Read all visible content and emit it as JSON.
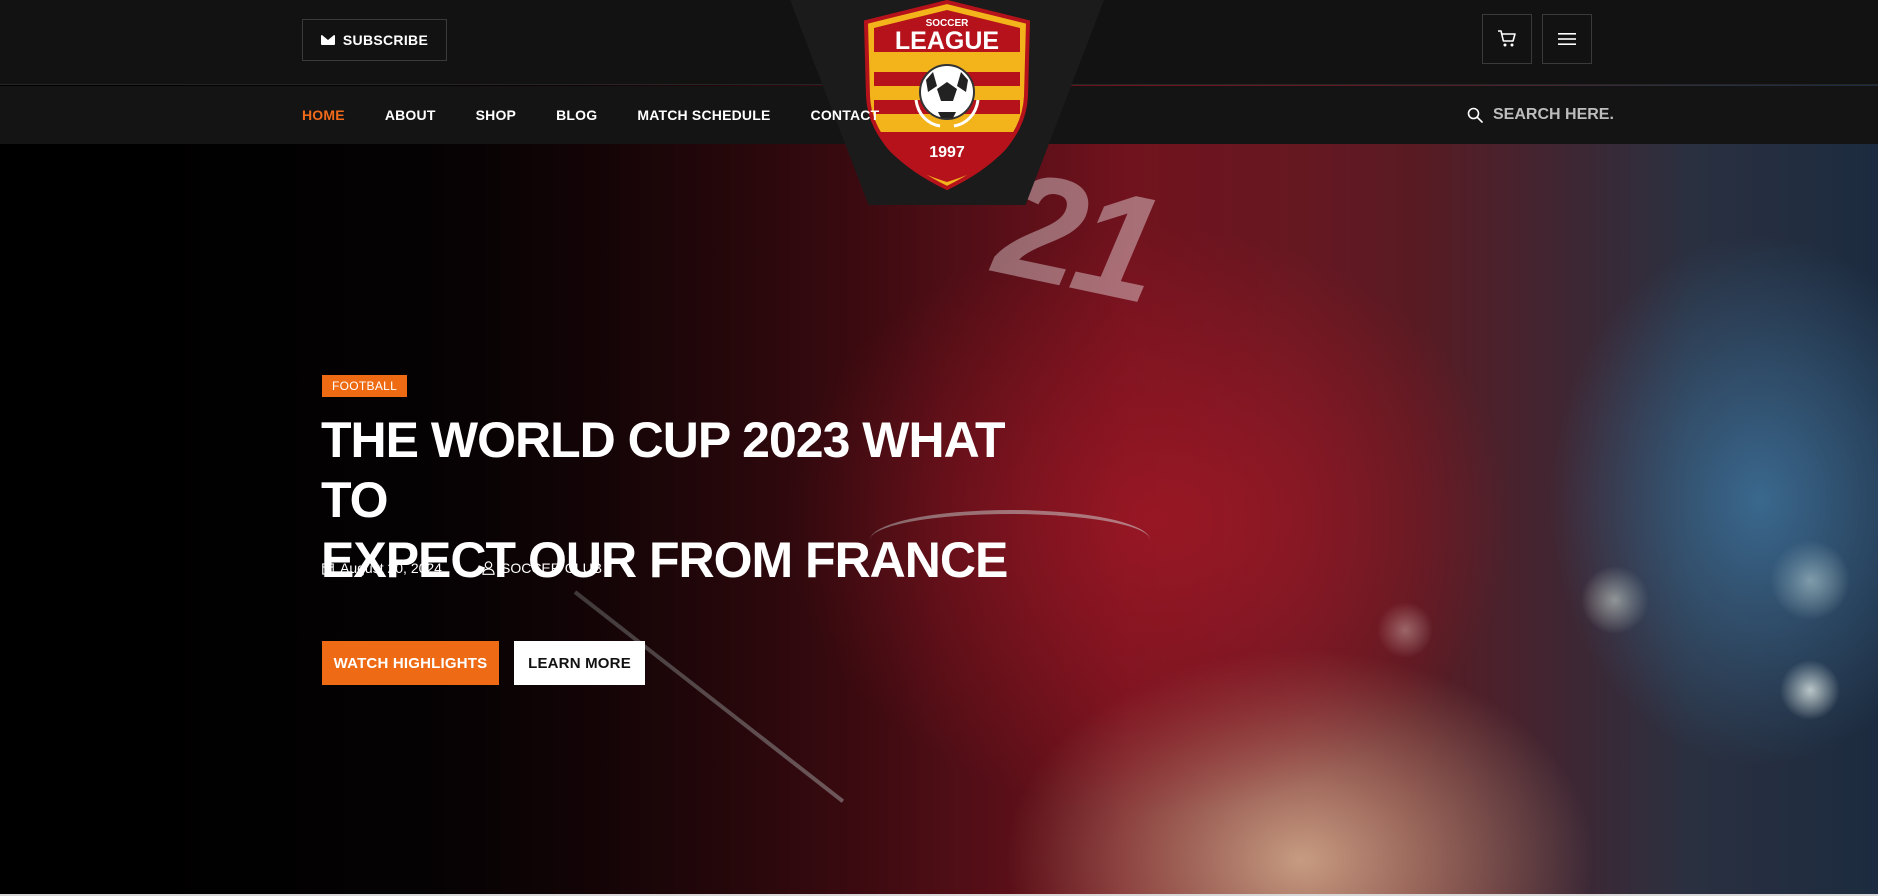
{
  "header": {
    "subscribe_label": "SUBSCRIBE",
    "cart_icon": "cart-icon",
    "menu_icon": "hamburger-menu-icon"
  },
  "logo": {
    "top_text": "SOCCER",
    "main_text": "LEAGUE",
    "year": "1997",
    "colors": {
      "shield_red": "#b5121b",
      "shield_yellow": "#f3b41b"
    }
  },
  "nav": {
    "items": [
      {
        "label": "HOME",
        "active": true
      },
      {
        "label": "ABOUT"
      },
      {
        "label": "SHOP"
      },
      {
        "label": "BLOG"
      },
      {
        "label": "MATCH SCHEDULE"
      },
      {
        "label": "CONTACT"
      }
    ]
  },
  "search": {
    "placeholder": "SEARCH HERE..."
  },
  "hero": {
    "tag": "FOOTBALL",
    "headline": "THE WORLD CUP 2023 WHAT TO\nEXPECT OUR FROM FRANCE",
    "date": "August 20, 2024",
    "author": "SOCCER CLUB",
    "primary_button": "WATCH HIGHLIGHTS",
    "secondary_button": "LEARN MORE",
    "shirt_number": "21"
  },
  "colors": {
    "accent": "#ef6a14",
    "topbar_bg": "#121212"
  }
}
